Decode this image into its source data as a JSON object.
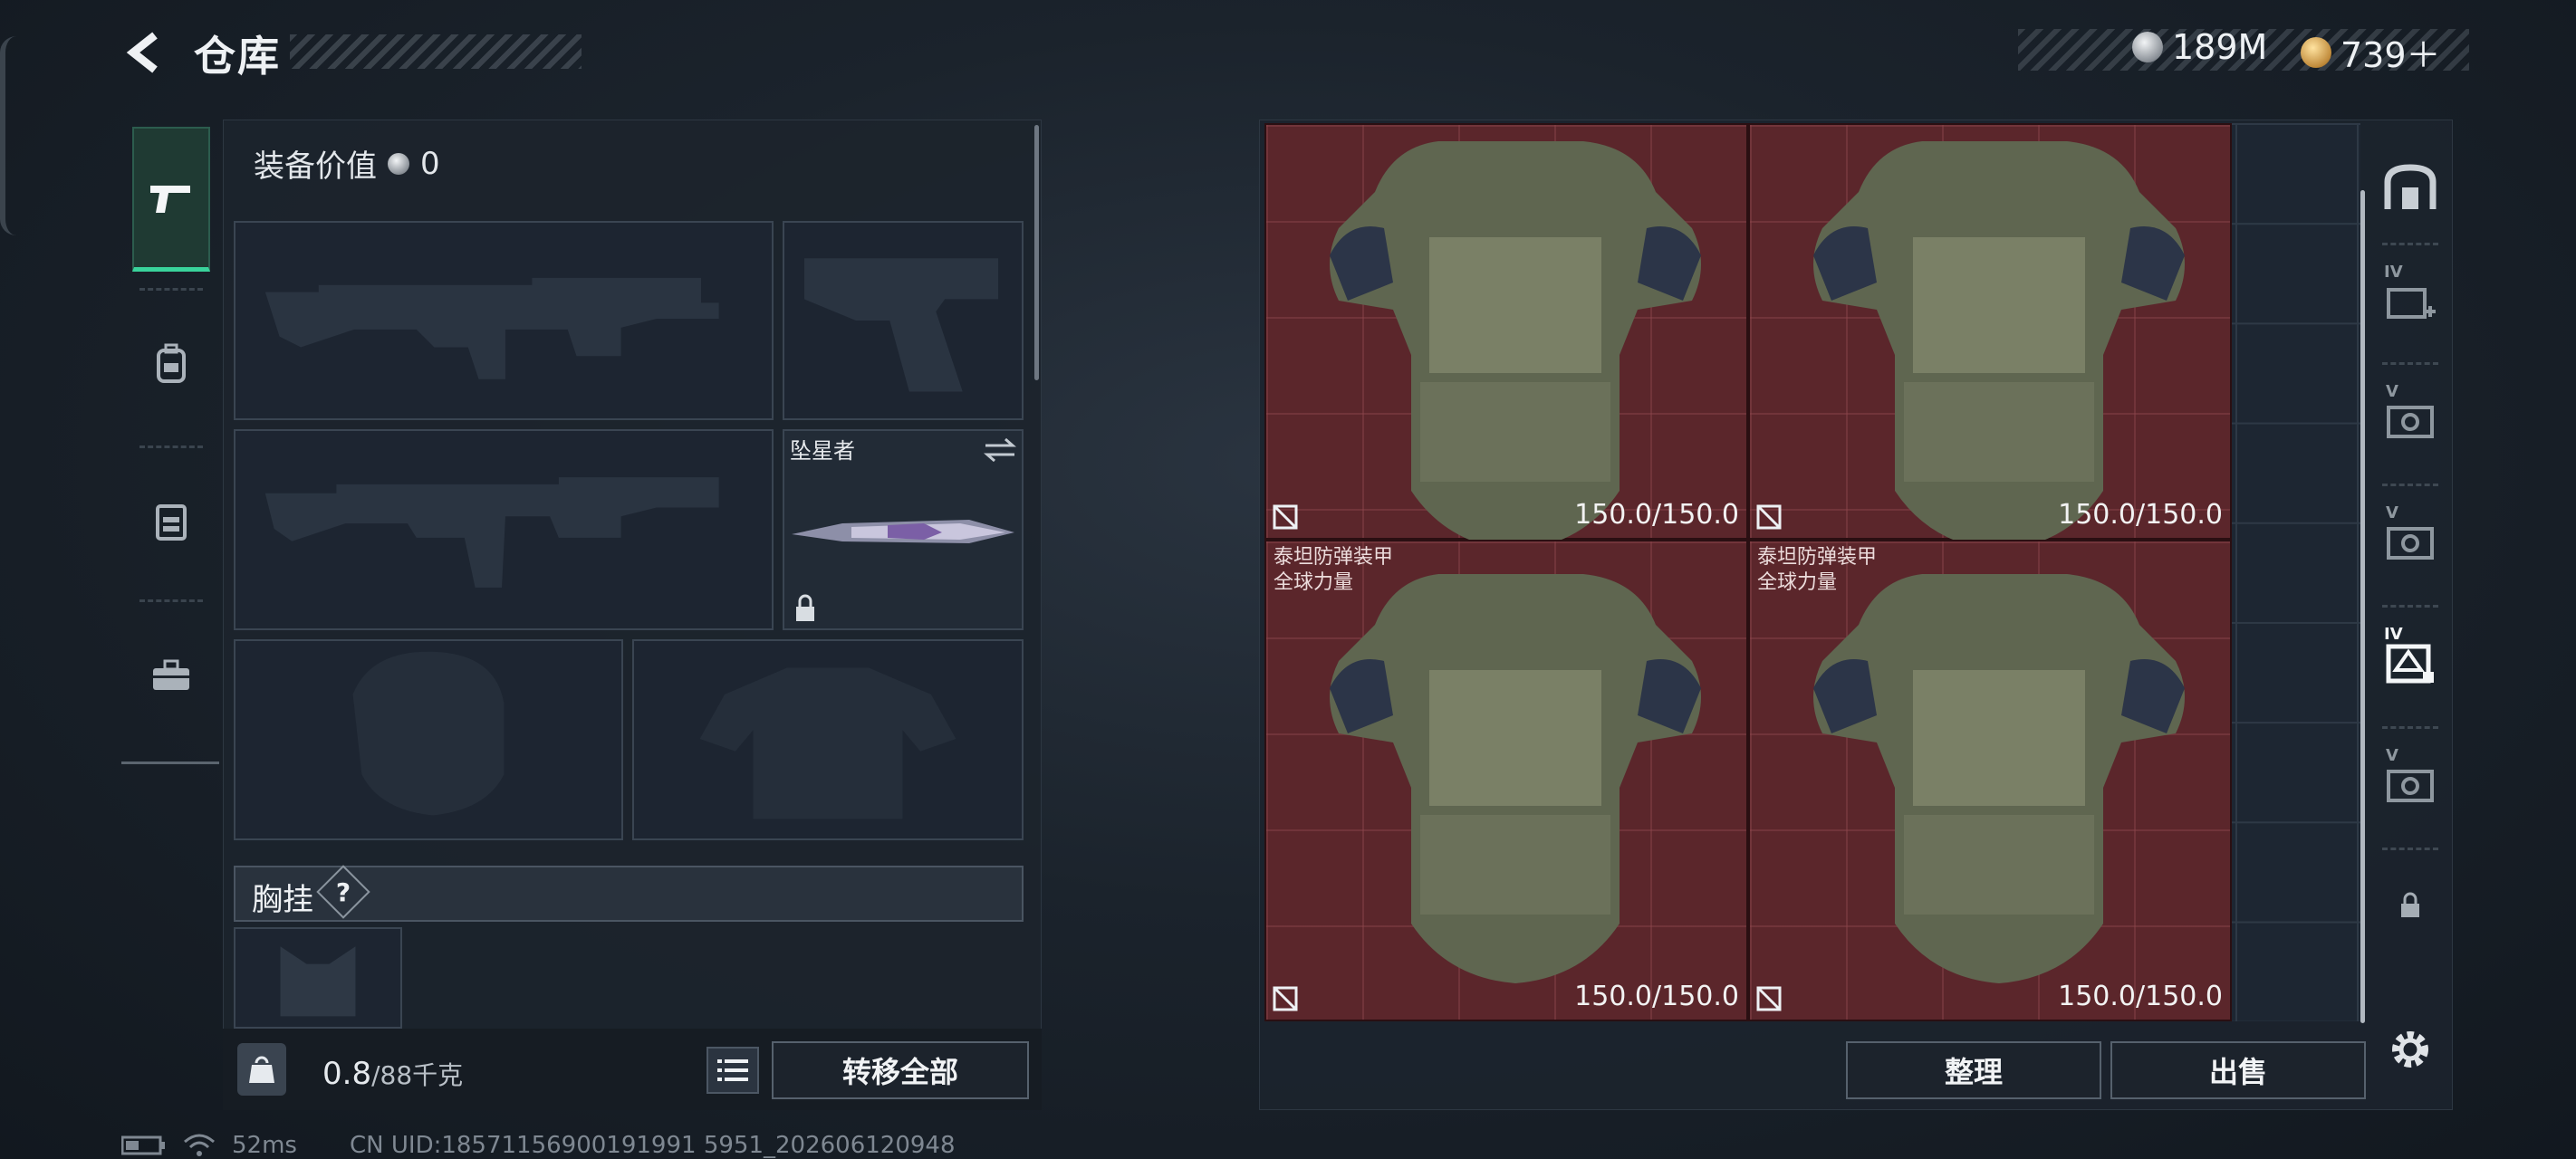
{
  "header": {
    "title": "仓库",
    "currencies": [
      {
        "icon": "silver-coin-icon",
        "value": "189M"
      },
      {
        "icon": "gold-coin-icon",
        "value": "739＋"
      }
    ]
  },
  "category_tabs": [
    {
      "icon": "pistol-icon",
      "selected": true
    },
    {
      "icon": "backpack-icon",
      "selected": false
    },
    {
      "icon": "chest-rig-icon",
      "selected": false
    },
    {
      "icon": "toolbox-icon",
      "selected": false
    }
  ],
  "equipment": {
    "value_label": "装备价值",
    "value_amount": "0",
    "melee_name": "坠星者",
    "chest_rig_label": "胸挂",
    "chest_rig_help": "?"
  },
  "weight": {
    "current": "0.8",
    "capacity": "/88千克",
    "icon_label": "KG"
  },
  "buttons": {
    "transfer_all": "转移全部",
    "sort": "整理",
    "sell": "出售"
  },
  "storage_items": [
    {
      "name_line1": "",
      "name_line2": "",
      "durability": "150.0/150.0"
    },
    {
      "name_line1": "",
      "name_line2": "",
      "durability": "150.0/150.0"
    },
    {
      "name_line1": "泰坦防弹装甲",
      "name_line2": "全球力量",
      "durability": "150.0/150.0"
    },
    {
      "name_line1": "泰坦防弹装甲",
      "name_line2": "全球力量",
      "durability": "150.0/150.0"
    }
  ],
  "containers": [
    {
      "icon": "safe-box-icon",
      "label": ""
    },
    {
      "icon": "backpack-plus-icon",
      "label": "IV"
    },
    {
      "icon": "case-v-icon",
      "label": "V"
    },
    {
      "icon": "case-v-icon",
      "label": "V"
    },
    {
      "icon": "case-iv-selected-icon",
      "label": "IV"
    },
    {
      "icon": "case-v-icon",
      "label": "V"
    },
    {
      "icon": "lock-icon",
      "label": ""
    }
  ],
  "status": {
    "ping": "52ms",
    "uid": "CN UID:18571156900191991 5951_202606120948"
  },
  "colors": {
    "accent": "#39d39b",
    "item_bg": "#5b262b",
    "panel": "#1c242d"
  }
}
